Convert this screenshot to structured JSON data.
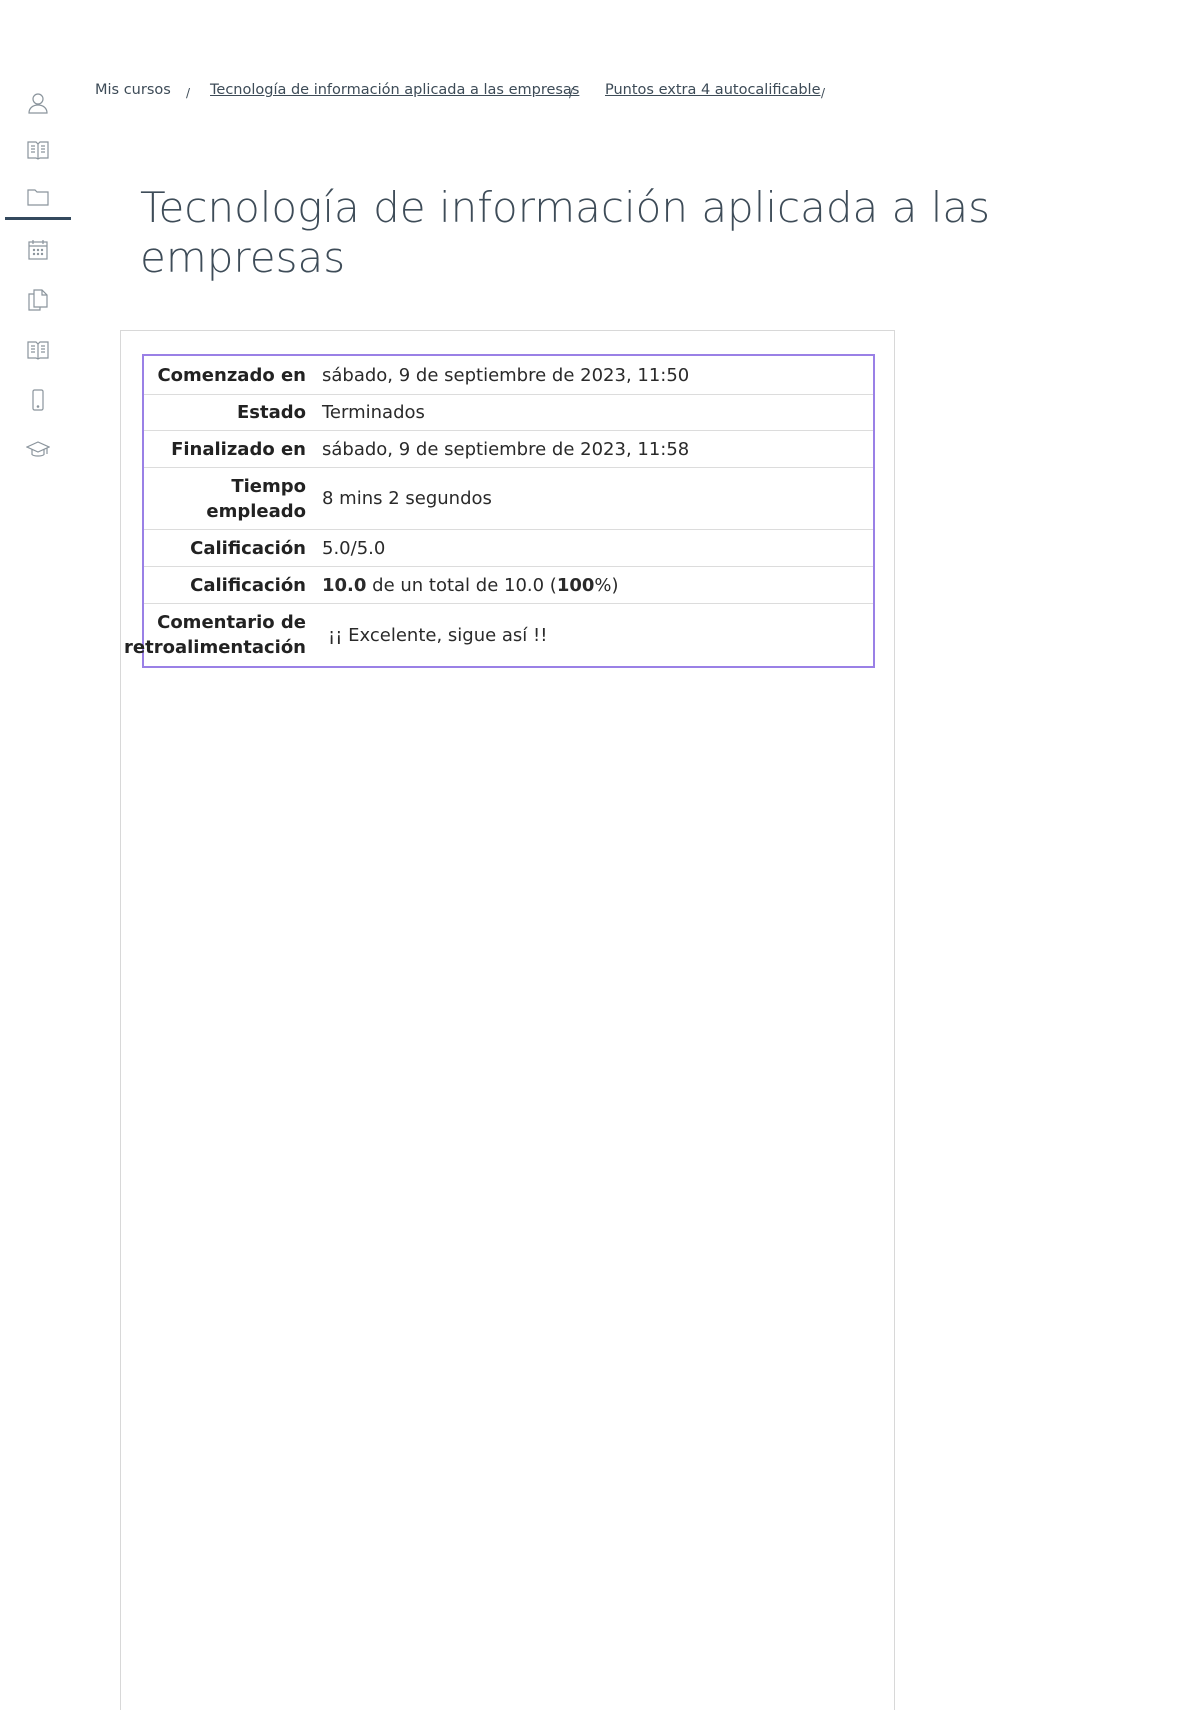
{
  "sidebar": {
    "items": [
      {
        "icon": "user-icon"
      },
      {
        "icon": "book-icon"
      },
      {
        "icon": "folder-icon",
        "active": true
      },
      {
        "icon": "calendar-icon"
      },
      {
        "icon": "files-icon"
      },
      {
        "icon": "book-icon"
      },
      {
        "icon": "mobile-icon"
      },
      {
        "icon": "graduation-cap-icon"
      }
    ]
  },
  "breadcrumb": {
    "items": [
      "Mis cursos",
      "Tecnología de información aplicada a las empresas",
      "Puntos extra 4 autocalificable"
    ],
    "separator": "/"
  },
  "page": {
    "title": "Tecnología de información aplicada a las empresas"
  },
  "summary": {
    "started_label": "Comenzado en",
    "started_value": "sábado, 9 de septiembre de 2023, 11:50",
    "state_label": "Estado",
    "state_value": "Terminados",
    "finished_label": "Finalizado en",
    "finished_value": "sábado, 9 de septiembre de 2023, 11:58",
    "time_label": "Tiempo empleado",
    "time_value": "8 mins 2 segundos",
    "marks_label": "Calificación",
    "marks_value": "5.0/5.0",
    "grade_label": "Calificación",
    "grade_score": "10.0",
    "grade_mid": " de un total de 10.0 (",
    "grade_percent": "100",
    "grade_end": "%)",
    "feedback_label": "Comentario de retroalimentación",
    "feedback_value": "¡¡ Excelente, sigue así !!"
  },
  "colors": {
    "title": "#3e4c58",
    "table_border": "#9a80e6",
    "sidebar_active": "#34495e"
  }
}
